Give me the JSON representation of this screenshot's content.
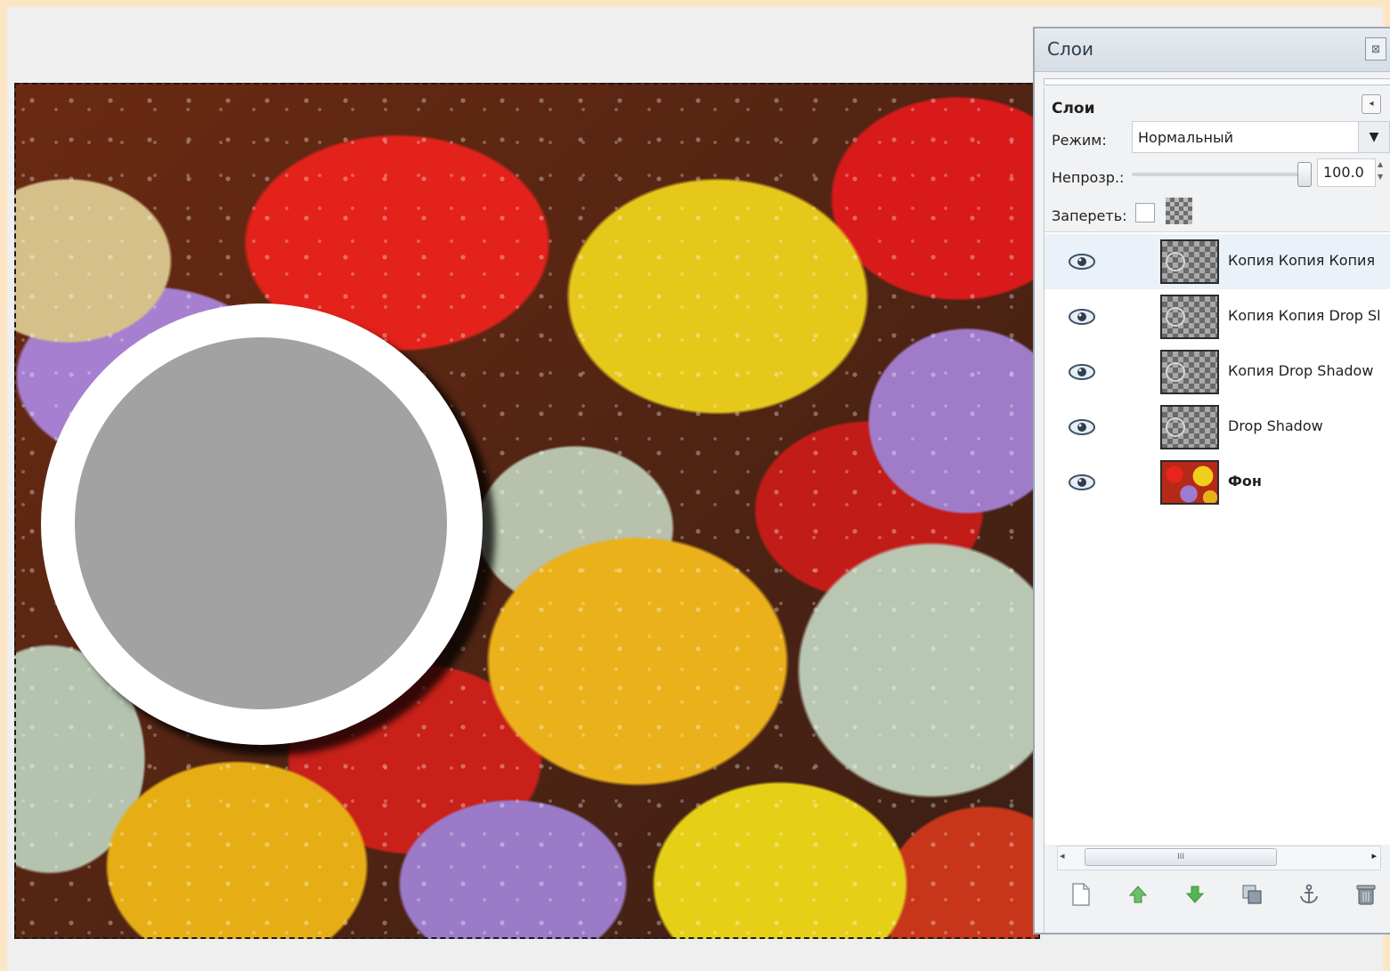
{
  "dock": {
    "title": "Слои",
    "close_glyph": "⊠"
  },
  "layers_panel": {
    "heading": "Слои",
    "mode_label": "Режим:",
    "mode_value": "Нормальный",
    "opacity_label": "Непрозр.:",
    "opacity_value": "100.0",
    "opacity_fraction": 1.0,
    "lock_label": "Запереть:"
  },
  "layers": [
    {
      "name": "Копия Копия Копия Drop Shadow",
      "visible": true,
      "selected": true,
      "thumb": "transparent-circle"
    },
    {
      "name": "Копия Копия Drop Shadow",
      "visible": true,
      "selected": false,
      "thumb": "transparent-circle"
    },
    {
      "name": "Копия Drop Shadow",
      "visible": true,
      "selected": false,
      "thumb": "transparent-circle"
    },
    {
      "name": "Drop Shadow",
      "visible": true,
      "selected": false,
      "thumb": "transparent-circle"
    },
    {
      "name": "Фон",
      "visible": true,
      "selected": false,
      "thumb": "photo",
      "bold": true
    }
  ],
  "scrollbar": {
    "grip": "III"
  },
  "toolbar": [
    {
      "icon": "new-layer-icon"
    },
    {
      "icon": "raise-layer-icon"
    },
    {
      "icon": "lower-layer-icon"
    },
    {
      "icon": "duplicate-layer-icon"
    },
    {
      "icon": "anchor-layer-icon"
    },
    {
      "icon": "delete-layer-icon"
    }
  ],
  "colors": {
    "page_background": "#fde6c6",
    "workspace": "#efefef",
    "ring_white": "#ffffff",
    "disc_gray": "#a2a2a2",
    "arrow_green": "#4caf50"
  }
}
